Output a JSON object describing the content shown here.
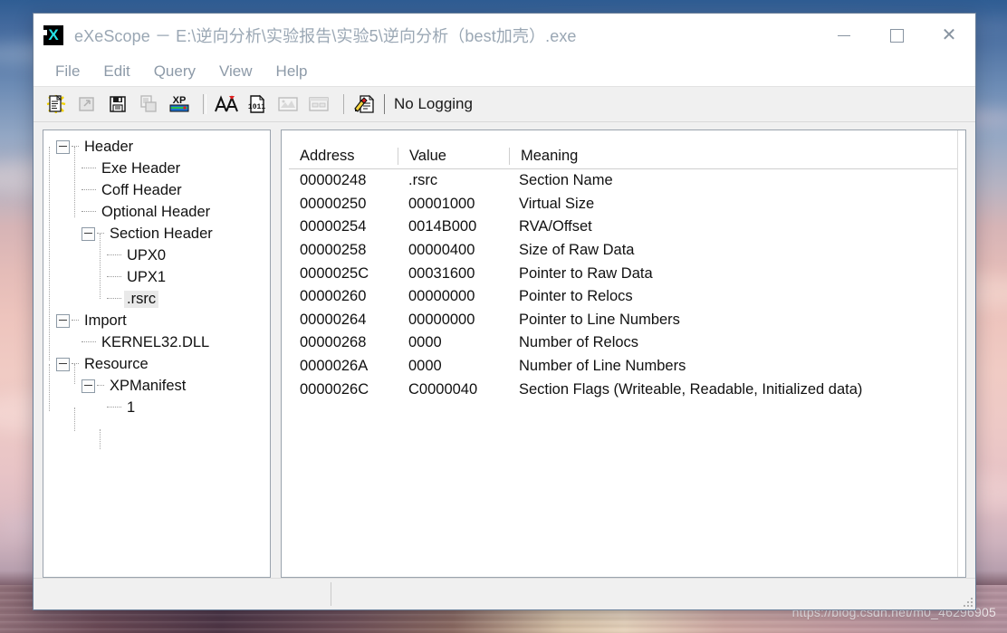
{
  "desktop": {
    "watermark": "https://blog.csdn.net/m0_46296905"
  },
  "window": {
    "title": "eXeScope － E:\\逆向分析\\实验报告\\实验5\\逆向分析（best加壳）.exe",
    "app_icon": "exescope-x-icon",
    "controls": {
      "minimize": "minimize-icon",
      "maximize": "maximize-icon",
      "close": "close-icon"
    }
  },
  "menubar": {
    "items": [
      {
        "label": "File"
      },
      {
        "label": "Edit"
      },
      {
        "label": "Query"
      },
      {
        "label": "View"
      },
      {
        "label": "Help"
      }
    ]
  },
  "toolbar": {
    "buttons": [
      {
        "name": "open-file-icon",
        "enabled": true
      },
      {
        "name": "export-file-icon",
        "enabled": false
      },
      {
        "name": "save-file-icon",
        "enabled": true
      },
      {
        "name": "copy-resource-icon",
        "enabled": false
      },
      {
        "name": "xp-manifest-icon",
        "enabled": true
      },
      {
        "name": "font-icon",
        "enabled": true
      },
      {
        "name": "binary-view-icon",
        "enabled": true
      },
      {
        "name": "bitmap-view-icon",
        "enabled": false
      },
      {
        "name": "dialog-view-icon",
        "enabled": false
      },
      {
        "name": "logging-icon",
        "enabled": true
      }
    ],
    "logging_status": "No Logging"
  },
  "tree": {
    "nodes": [
      {
        "label": "Header",
        "level": 1,
        "expander": true,
        "selected": false
      },
      {
        "label": "Exe Header",
        "level": 2,
        "expander": false,
        "selected": false
      },
      {
        "label": "Coff Header",
        "level": 2,
        "expander": false,
        "selected": false
      },
      {
        "label": "Optional Header",
        "level": 2,
        "expander": false,
        "selected": false
      },
      {
        "label": "Section Header",
        "level": 2,
        "expander": true,
        "selected": false
      },
      {
        "label": "UPX0",
        "level": 3,
        "expander": false,
        "selected": false
      },
      {
        "label": "UPX1",
        "level": 3,
        "expander": false,
        "selected": false
      },
      {
        "label": ".rsrc",
        "level": 3,
        "expander": false,
        "selected": true
      },
      {
        "label": "Import",
        "level": 1,
        "expander": true,
        "selected": false
      },
      {
        "label": "KERNEL32.DLL",
        "level": 2,
        "expander": false,
        "selected": false
      },
      {
        "label": "Resource",
        "level": 1,
        "expander": true,
        "selected": false
      },
      {
        "label": "XPManifest",
        "level": 2,
        "expander": true,
        "selected": false
      },
      {
        "label": "1",
        "level": 3,
        "expander": false,
        "selected": false
      }
    ]
  },
  "listview": {
    "columns": [
      "Address",
      "Value",
      "Meaning"
    ],
    "rows": [
      {
        "address": "00000248",
        "value": ".rsrc",
        "meaning": "Section Name"
      },
      {
        "address": "00000250",
        "value": "00001000",
        "meaning": "Virtual Size"
      },
      {
        "address": "00000254",
        "value": "0014B000",
        "meaning": "RVA/Offset"
      },
      {
        "address": "00000258",
        "value": "00000400",
        "meaning": "Size of Raw Data"
      },
      {
        "address": "0000025C",
        "value": "00031600",
        "meaning": "Pointer to Raw Data"
      },
      {
        "address": "00000260",
        "value": "00000000",
        "meaning": "Pointer to Relocs"
      },
      {
        "address": "00000264",
        "value": "00000000",
        "meaning": "Pointer to Line Numbers"
      },
      {
        "address": "00000268",
        "value": "0000",
        "meaning": "Number of Relocs"
      },
      {
        "address": "0000026A",
        "value": "0000",
        "meaning": "Number of Line Numbers"
      },
      {
        "address": "0000026C",
        "value": "C0000040",
        "meaning": "Section Flags (Writeable, Readable, Initialized data)"
      }
    ]
  },
  "statusbar": {
    "pane1": "",
    "pane2": "",
    "resize_grip": "resize-grip-icon"
  },
  "colors": {
    "window_border": "#6a7f99",
    "title_text": "#9aa7b4",
    "menu_text": "#8d9aa8",
    "panel_border": "#9aa3ad",
    "selection": "#e9e9e9"
  }
}
